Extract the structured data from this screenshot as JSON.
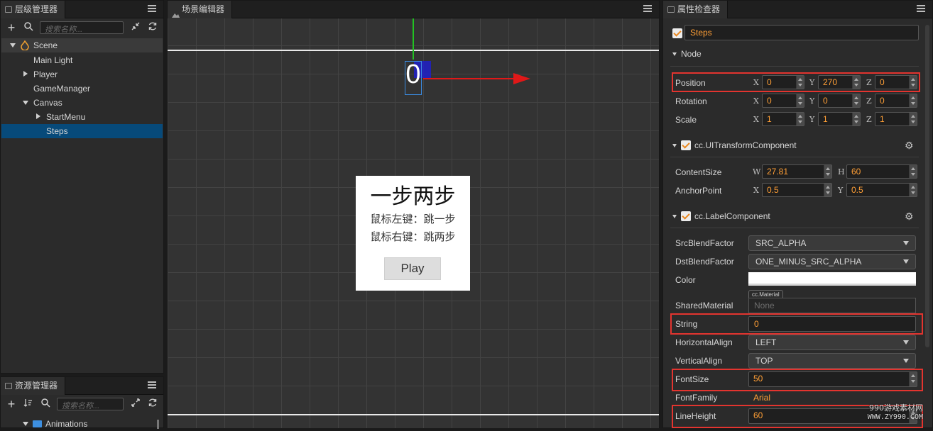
{
  "hierarchy": {
    "title": "层级管理器",
    "search_placeholder": "搜索名称...",
    "items": [
      {
        "label": "Scene"
      },
      {
        "label": "Main Light"
      },
      {
        "label": "Player"
      },
      {
        "label": "GameManager"
      },
      {
        "label": "Canvas"
      },
      {
        "label": "StartMenu"
      },
      {
        "label": "Steps"
      }
    ]
  },
  "assets": {
    "title": "资源管理器",
    "search_placeholder": "搜索名称...",
    "items": [
      {
        "label": "Animations"
      }
    ]
  },
  "scene": {
    "title": "场景编辑器",
    "popup": {
      "title": "一步两步",
      "line1": "鼠标左键：跳一步",
      "line2": "鼠标右键：跳两步",
      "button": "Play"
    },
    "selected_label": "0"
  },
  "inspector": {
    "title": "属性检查器",
    "node_name": "Steps",
    "node_section": "Node",
    "position": {
      "label": "Position",
      "x": "0",
      "y": "270",
      "z": "0"
    },
    "rotation": {
      "label": "Rotation",
      "x": "0",
      "y": "0",
      "z": "0"
    },
    "scale": {
      "label": "Scale",
      "x": "1",
      "y": "1",
      "z": "1"
    },
    "axes": {
      "x": "X",
      "y": "Y",
      "z": "Z",
      "w": "W",
      "h": "H"
    },
    "uitransform": {
      "title": "cc.UITransformComponent",
      "content_size": {
        "label": "ContentSize",
        "w": "27.81",
        "h": "60"
      },
      "anchor_point": {
        "label": "AnchorPoint",
        "x": "0.5",
        "y": "0.5"
      }
    },
    "label_component": {
      "title": "cc.LabelComponent",
      "src_blend": {
        "label": "SrcBlendFactor",
        "value": "SRC_ALPHA"
      },
      "dst_blend": {
        "label": "DstBlendFactor",
        "value": "ONE_MINUS_SRC_ALPHA"
      },
      "color": {
        "label": "Color",
        "value": "#ffffff"
      },
      "shared_material": {
        "label": "SharedMaterial",
        "tag": "cc.Material",
        "value": "None"
      },
      "string": {
        "label": "String",
        "value": "0"
      },
      "h_align": {
        "label": "HorizontalAlign",
        "value": "LEFT"
      },
      "v_align": {
        "label": "VerticalAlign",
        "value": "TOP"
      },
      "font_size": {
        "label": "FontSize",
        "value": "50"
      },
      "font_family": {
        "label": "FontFamily",
        "value": "Arial"
      },
      "line_height": {
        "label": "LineHeight",
        "value": "60"
      }
    }
  },
  "watermark": {
    "line1": "990游戏素材网",
    "line2": "WWW.ZY990.COM"
  },
  "colors": {
    "accent": "#ff9f36",
    "selection": "#074a7a",
    "highlight": "#e3342f",
    "gizmo_x": "#e01818",
    "gizmo_y": "#22c222"
  }
}
